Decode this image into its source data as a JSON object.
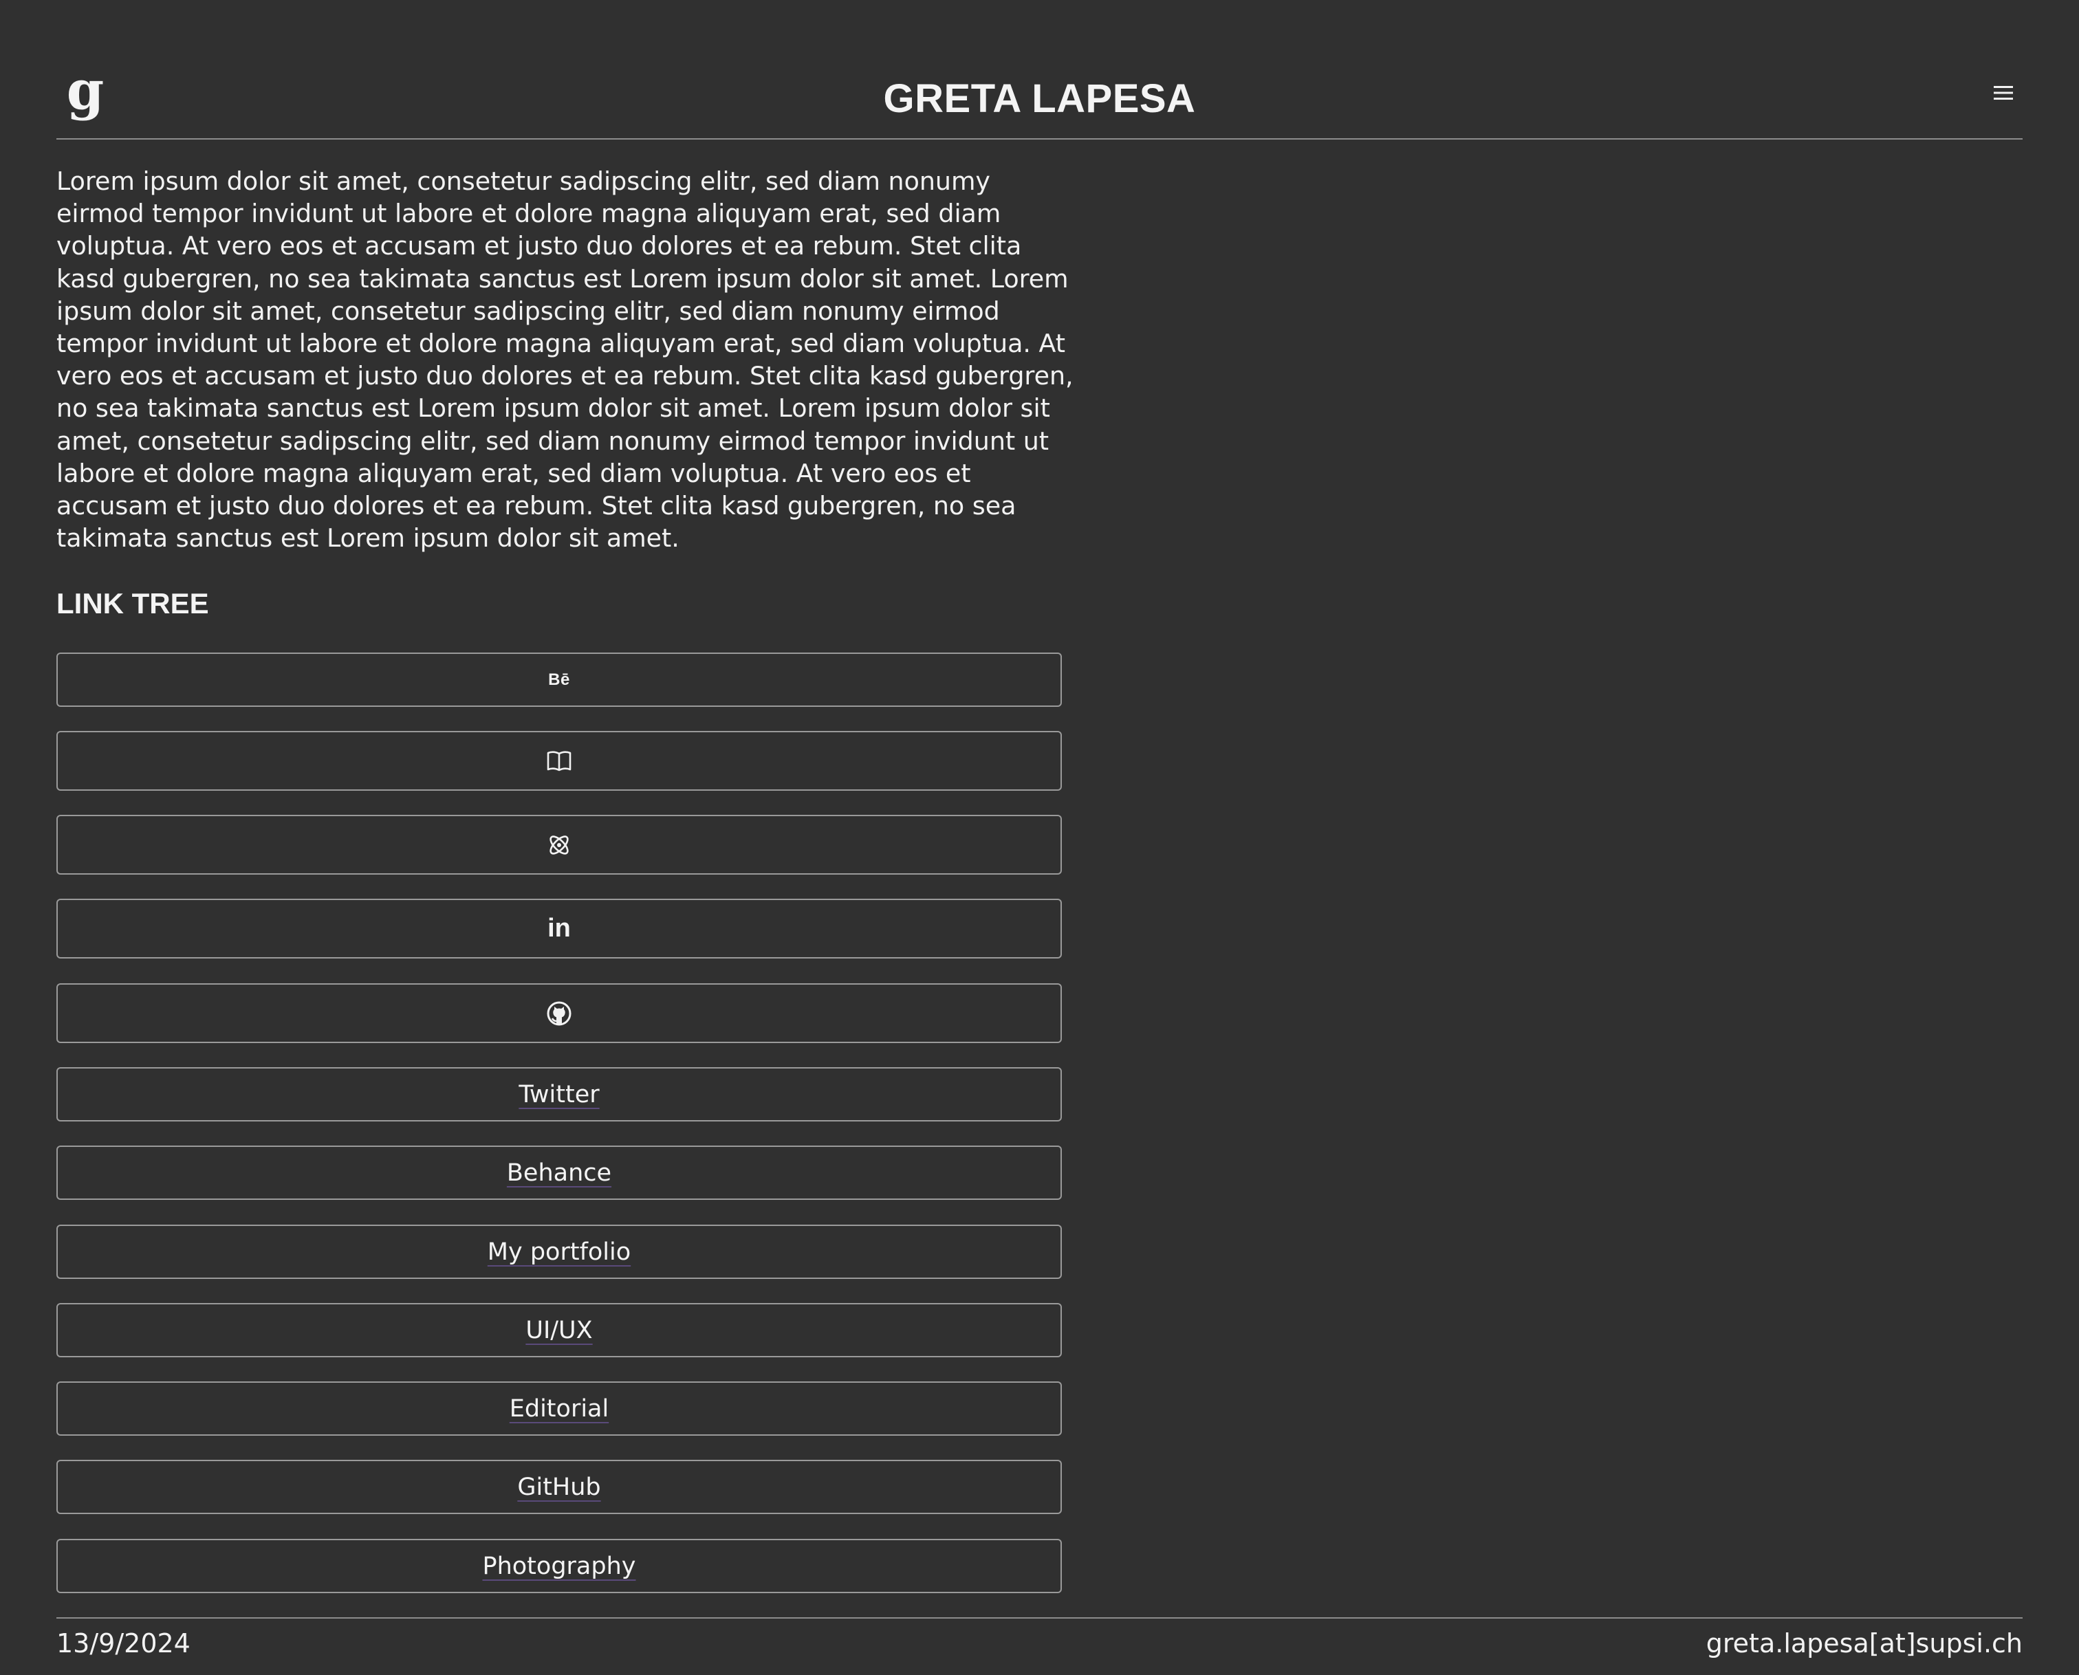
{
  "header": {
    "logo_letter": "g",
    "title": "GRETA LAPESA",
    "menu_icon": "hamburger-menu-icon"
  },
  "intro": {
    "text": "Lorem ipsum dolor sit amet, consetetur sadipscing elitr, sed diam nonumy eirmod tempor invidunt ut labore et dolore magna aliquyam erat, sed diam voluptua. At vero eos et accusam et justo duo dolores et ea rebum. Stet clita kasd gubergren, no sea takimata sanctus est Lorem ipsum dolor sit amet. Lorem ipsum dolor sit amet, consetetur sadipscing elitr, sed diam nonumy eirmod tempor invidunt ut labore et dolore magna aliquyam erat, sed diam voluptua. At vero eos et accusam et justo duo dolores et ea rebum. Stet clita kasd gubergren, no sea takimata sanctus est Lorem ipsum dolor sit amet. Lorem ipsum dolor sit amet, consetetur sadipscing elitr, sed diam nonumy eirmod tempor invidunt ut labore et dolore magna aliquyam erat, sed diam voluptua. At vero eos et accusam et justo duo dolores et ea rebum. Stet clita kasd gubergren, no sea takimata sanctus est Lorem ipsum dolor sit amet."
  },
  "link_tree": {
    "title": "LINK TREE",
    "icon_links": [
      {
        "icon": "behance-icon",
        "glyph": "Bē"
      },
      {
        "icon": "book-icon"
      },
      {
        "icon": "atom-icon"
      },
      {
        "icon": "linkedin-icon",
        "glyph": "in"
      },
      {
        "icon": "github-icon"
      }
    ],
    "text_links": [
      "Twitter",
      "Behance",
      "My portfolio",
      "UI/UX",
      "Editorial",
      "GitHub",
      "Photography"
    ]
  },
  "footer": {
    "date": "13/9/2024",
    "email": "greta.lapesa[at]supsi.ch"
  },
  "colors": {
    "background": "#303030",
    "text": "#f2f2f2",
    "border": "#9a9a9a",
    "link_underline": "#5a4a7a"
  }
}
